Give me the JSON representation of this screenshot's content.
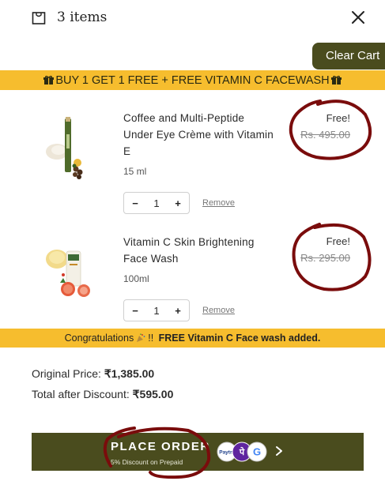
{
  "header": {
    "title": "3 items",
    "icon": "shopping-bag-icon",
    "close_icon": "close-icon"
  },
  "clear_cart_label": "Clear Cart",
  "promo_banner": {
    "text": "BUY 1 GET 1 FREE + FREE VITAMIN C FACEWASH",
    "icon": "gift-icon"
  },
  "items": [
    {
      "name": "Coffee and Multi-Peptide Under Eye Crème with Vitamin E",
      "size": "15 ml",
      "price_free": "Free!",
      "price_old": "Rs. 495.00",
      "quantity": "1",
      "remove_label": "Remove"
    },
    {
      "name": "Vitamin C Skin Brightening Face Wash",
      "size": "100ml",
      "price_free": "Free!",
      "price_old": "Rs. 295.00",
      "quantity": "1",
      "remove_label": "Remove"
    }
  ],
  "congrats": {
    "prefix": "Congratulations",
    "emoji_icon": "party-popper-icon",
    "middle": "!! ",
    "bold": "FREE Vitamin C Face wash added."
  },
  "summary": {
    "original_label": "Original Price:",
    "original_value": "₹1,385.00",
    "discount_label": "Total after Discount:",
    "discount_value": "₹595.00"
  },
  "place_order": {
    "label": "PLACE ORDER",
    "sub": "5% Discount on Prepaid",
    "payment_icons": [
      "paytm-icon",
      "phonepe-icon",
      "google-pay-icon"
    ],
    "paytm_text": "Paytm",
    "phonepe_text": "पे",
    "gpay_text": "G"
  },
  "colors": {
    "olive": "#4a4c1e",
    "banner_yellow": "#f6bd2e",
    "annotation_red": "#7a0c0c"
  }
}
